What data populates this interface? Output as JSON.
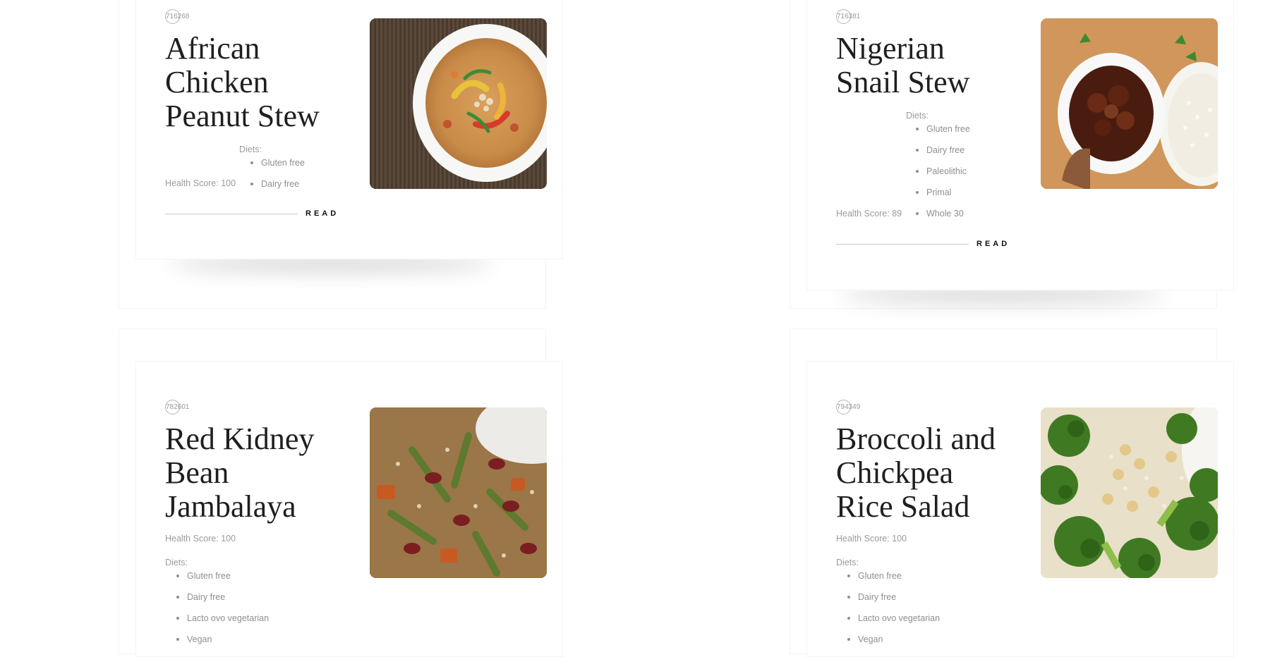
{
  "recipes": [
    {
      "id": "716268",
      "title_lines": [
        "African",
        "Chicken",
        "Peanut Stew"
      ],
      "health_score": "Health Score: 100",
      "diets_label": "Diets:",
      "diets": [
        "Gluten free",
        "Dairy free"
      ],
      "read_label": "READ"
    },
    {
      "id": "716381",
      "title_lines": [
        "Nigerian",
        "Snail Stew"
      ],
      "health_score": "Health Score: 89",
      "diets_label": "Diets:",
      "diets": [
        "Gluten free",
        "Dairy free",
        "Paleolithic",
        "Primal",
        "Whole 30"
      ],
      "read_label": "READ"
    },
    {
      "id": "782601",
      "title_lines": [
        "Red Kidney",
        "Bean",
        "Jambalaya"
      ],
      "health_score": "Health Score: 100",
      "diets_label": "Diets:",
      "diets": [
        "Gluten free",
        "Dairy free",
        "Lacto ovo vegetarian",
        "Vegan"
      ]
    },
    {
      "id": "794349",
      "title_lines": [
        "Broccoli and",
        "Chickpea",
        "Rice Salad"
      ],
      "health_score": "Health Score: 100",
      "diets_label": "Diets:",
      "diets": [
        "Gluten free",
        "Dairy free",
        "Lacto ovo vegetarian",
        "Vegan"
      ]
    }
  ],
  "colors": {
    "text_muted": "#9b9b9b",
    "title": "#1f1f1f",
    "read_link": "#111111"
  }
}
